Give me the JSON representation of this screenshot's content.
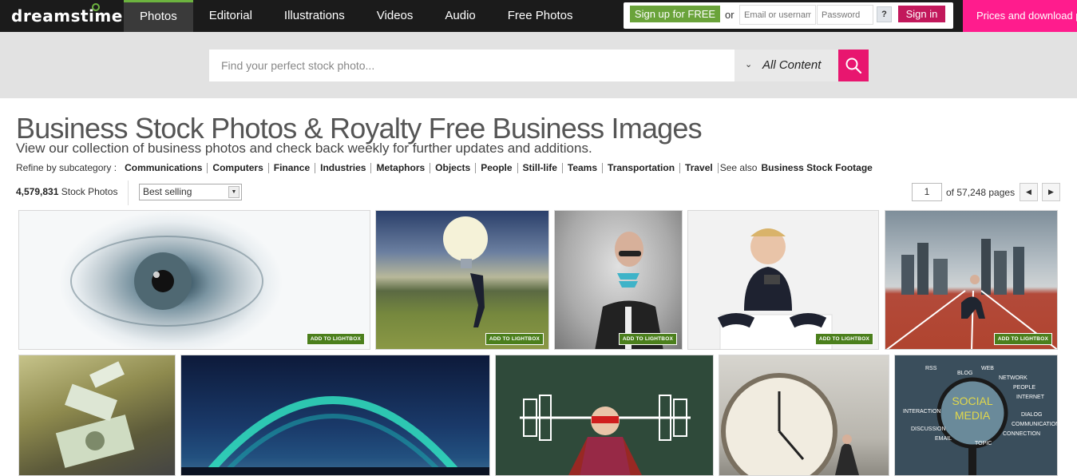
{
  "header": {
    "logo": "dreamstime",
    "logo_reg": "®",
    "nav": [
      "Photos",
      "Editorial",
      "Illustrations",
      "Videos",
      "Audio",
      "Free Photos"
    ],
    "active_nav": "Photos",
    "signup_label": "Sign up for FREE",
    "or_text": "or",
    "email_placeholder": "Email or username",
    "password_placeholder": "Password",
    "help_label": "?",
    "signin_label": "Sign in",
    "promo_text": "Prices and download plans"
  },
  "search": {
    "placeholder": "Find your perfect stock photo...",
    "content_filter": "All Content"
  },
  "page": {
    "title": "Business Stock Photos & Royalty Free Business Images",
    "subtitle": "View our collection of business photos and check back weekly for further updates and additions.",
    "refine_label": "Refine by subcategory :",
    "subcategories": [
      "Communications",
      "Computers",
      "Finance",
      "Industries",
      "Metaphors",
      "Objects",
      "People",
      "Still-life",
      "Teams",
      "Transportation",
      "Travel"
    ],
    "see_also_label": "See also",
    "see_also_link": "Business Stock Footage",
    "count": "4,579,831",
    "count_suffix": "Stock Photos",
    "sort_value": "Best selling",
    "page_number": "1",
    "page_total": "of 57,248 pages"
  },
  "thumbnails": [
    {
      "subject": "eye",
      "lightbox": "ADD TO LIGHTBOX"
    },
    {
      "subject": "man-carrying-lightbulb",
      "lightbox": "ADD TO LIGHTBOX"
    },
    {
      "subject": "businessman-spring",
      "lightbox": "ADD TO LIGHTBOX"
    },
    {
      "subject": "baby-with-phone",
      "lightbox": "ADD TO LIGHTBOX"
    },
    {
      "subject": "businessman-starting-block",
      "lightbox": "ADD TO LIGHTBOX"
    },
    {
      "subject": "flying-money"
    },
    {
      "subject": "aurora-dome"
    },
    {
      "subject": "superhero-kid-weights"
    },
    {
      "subject": "clock-man-pushing"
    },
    {
      "subject": "social-media-magnifier"
    }
  ],
  "colors": {
    "accent": "#6cb33f",
    "signin": "#c2185b",
    "promo": "#ff1c8d",
    "search_button": "#e8166f",
    "lightbox": "#4b7f1c"
  }
}
